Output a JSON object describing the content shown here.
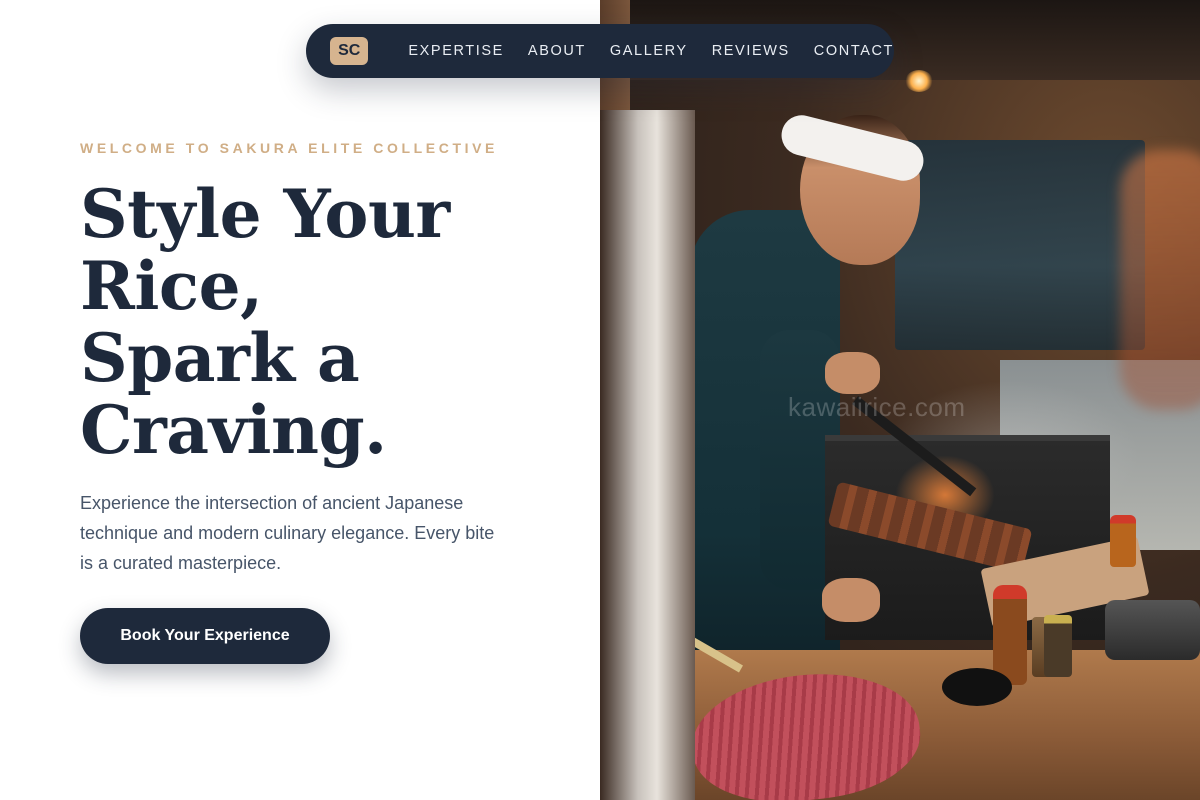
{
  "nav": {
    "logo": "SC",
    "links": [
      "EXPERTISE",
      "ABOUT",
      "GALLERY",
      "REVIEWS",
      "CONTACT"
    ]
  },
  "hero": {
    "eyebrow": "WELCOME TO SAKURA ELITE COLLECTIVE",
    "headline_lines": [
      "Style Your",
      "Rice,",
      "Spark a",
      "Craving."
    ],
    "description": "Experience the intersection of ancient Japanese technique and modern culinary elegance. Every bite is a curated masterpiece.",
    "cta_label": "Book Your Experience"
  },
  "image": {
    "watermark": "kawaiirice.com"
  },
  "colors": {
    "navy": "#1e293b",
    "accent_tan": "#d6b48f",
    "eyebrow": "#d0ae86",
    "body_text": "#475569",
    "background": "#ffffff"
  }
}
